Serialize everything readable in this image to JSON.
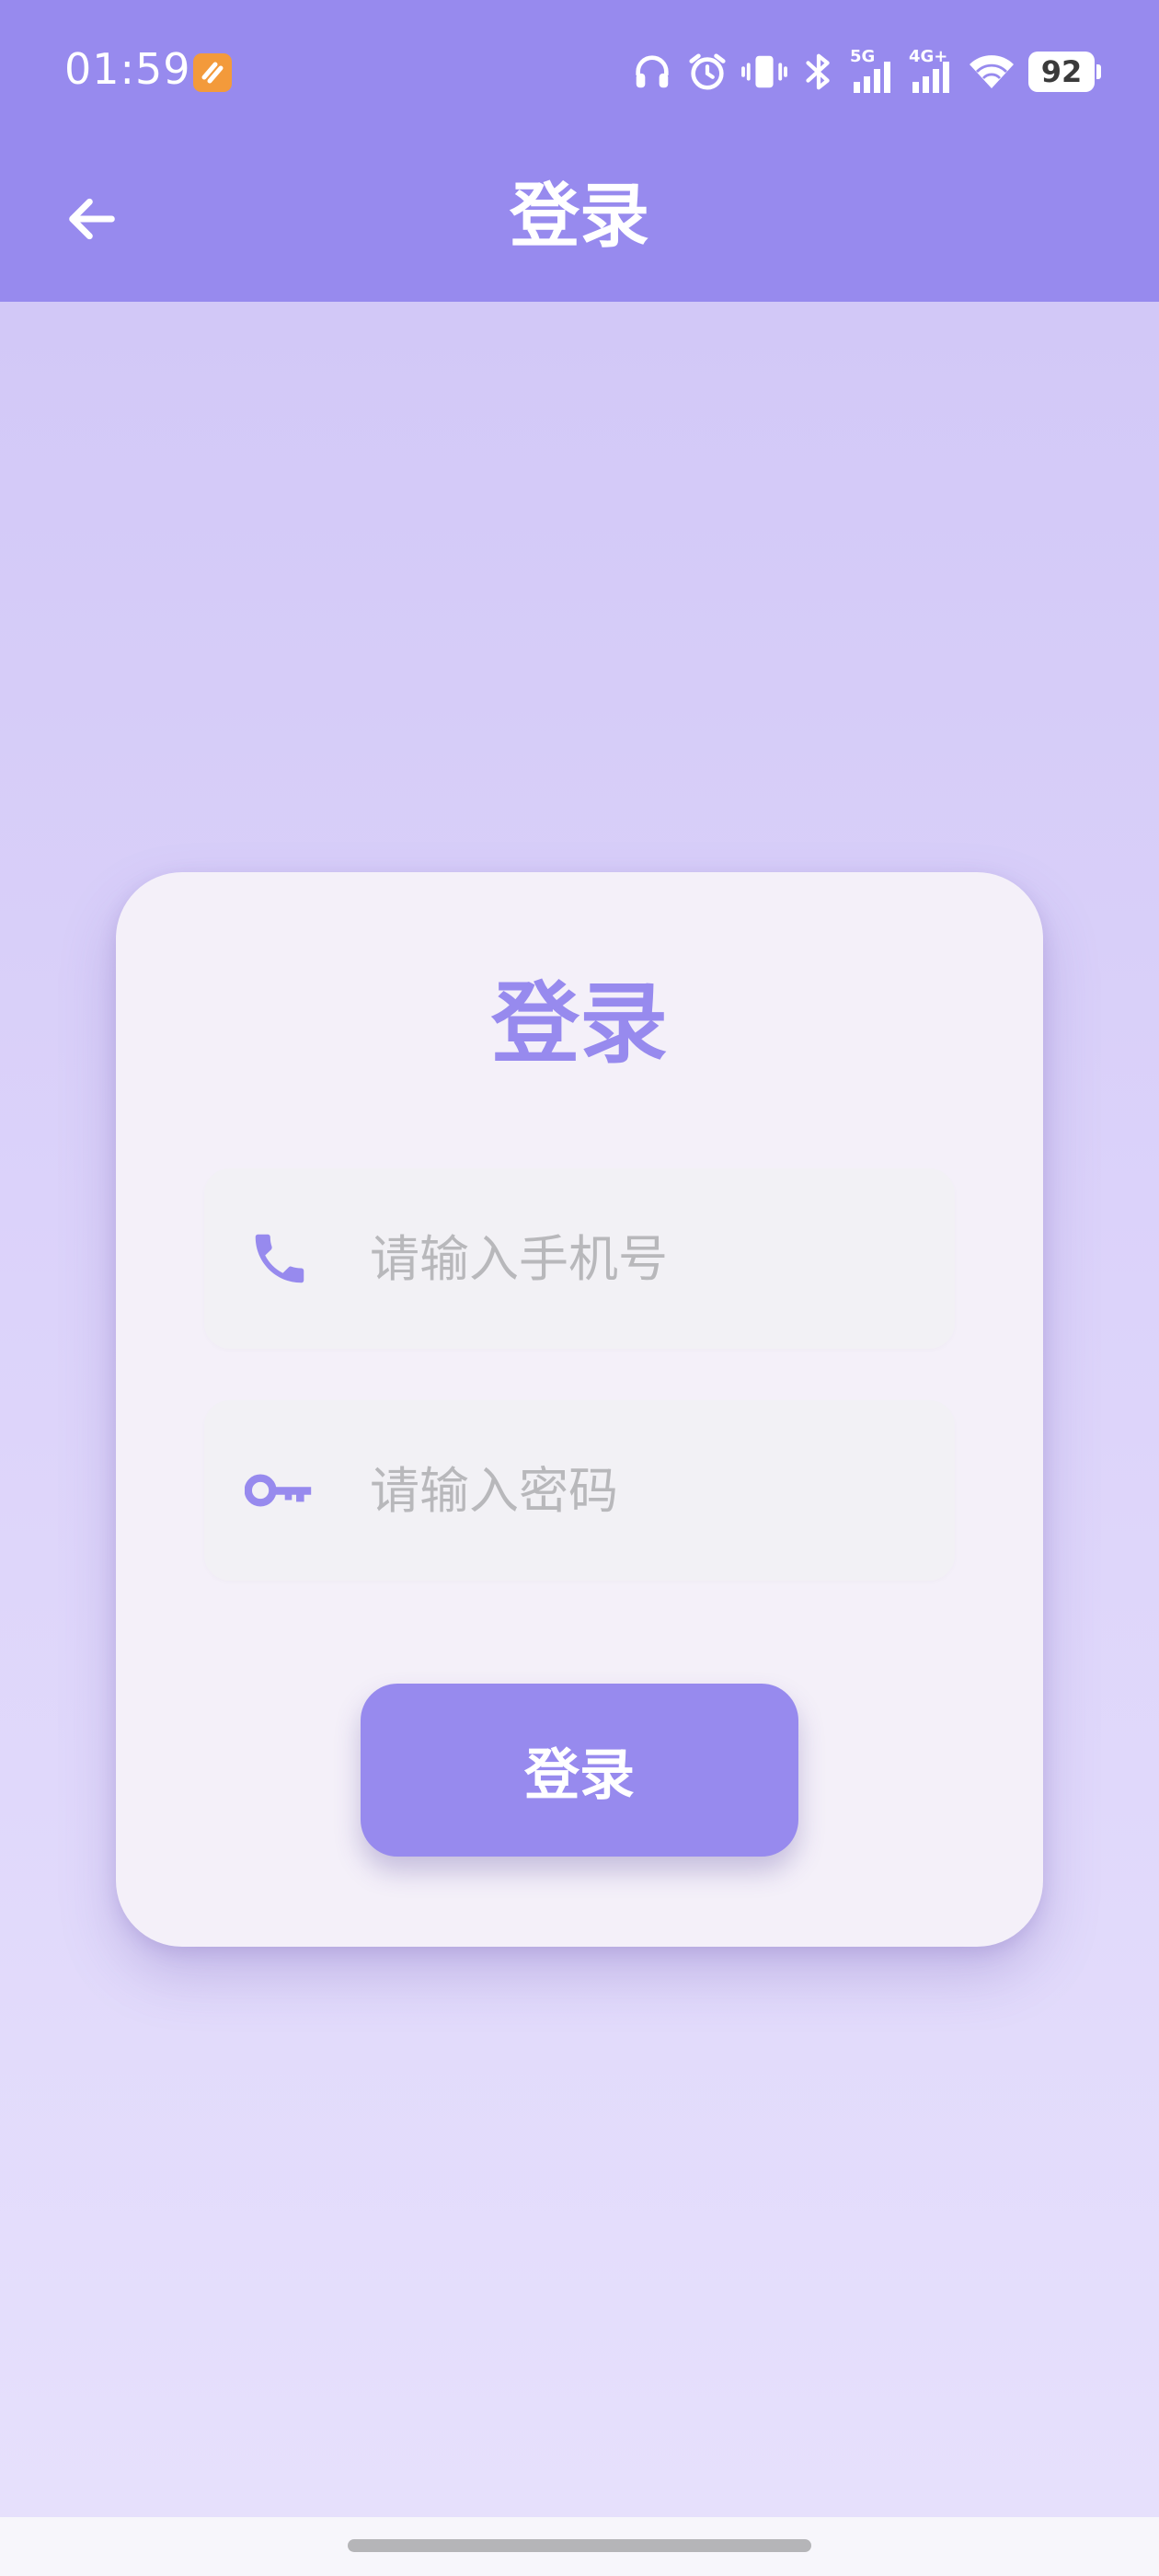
{
  "status_bar": {
    "time": "01:59",
    "network_5g": "5G",
    "network_4g": "4G+",
    "battery": "92",
    "icons": [
      "notification-app-icon",
      "headphones-icon",
      "alarm-icon",
      "vibrate-icon",
      "bluetooth-icon",
      "signal-5g-icon",
      "signal-4g-icon",
      "wifi-icon",
      "battery-icon"
    ]
  },
  "app_bar": {
    "title": "登录",
    "back_icon": "arrow-left-icon"
  },
  "login_card": {
    "title": "登录",
    "phone_field": {
      "placeholder": "请输入手机号",
      "value": "",
      "icon": "phone-icon"
    },
    "password_field": {
      "placeholder": "请输入密码",
      "value": "",
      "icon": "key-icon"
    },
    "login_button_label": "登录"
  },
  "colors": {
    "accent": "#978aee",
    "background_top": "#d2c8f7",
    "background_bottom": "#e6e0fc",
    "card": "#f4f0f9",
    "field": "#f2f1f5",
    "placeholder": "#b8b8bb"
  }
}
